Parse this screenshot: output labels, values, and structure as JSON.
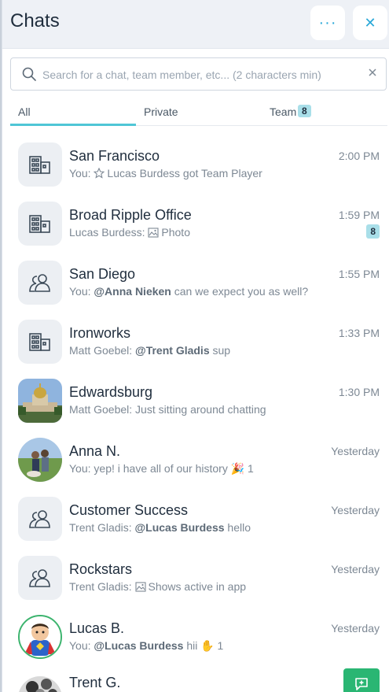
{
  "header": {
    "title": "Chats",
    "more_label": "···",
    "close_label": "✕"
  },
  "search": {
    "placeholder": "Search for a chat, team member, etc... (2 characters min)",
    "value": ""
  },
  "tabs": [
    {
      "label": "All",
      "active": true
    },
    {
      "label": "Private"
    },
    {
      "label": "Team",
      "badge": "8"
    }
  ],
  "chats": [
    {
      "name": "San Francisco",
      "time": "2:00 PM",
      "avatar": "building-icon",
      "preview_prefix": "You: ",
      "preview_icon": "star-icon",
      "preview_text": "Lucas Burdess got Team Player"
    },
    {
      "name": "Broad Ripple Office",
      "time": "1:59 PM",
      "avatar": "building-icon",
      "preview_prefix": "Lucas Burdess: ",
      "preview_icon": "image-icon",
      "preview_text": "Photo",
      "unread": "8"
    },
    {
      "name": "San Diego",
      "time": "1:55 PM",
      "avatar": "group-icon",
      "preview_prefix": "You: ",
      "preview_mention": "@Anna Nieken",
      "preview_text": " can we expect you as well?"
    },
    {
      "name": "Ironworks",
      "time": "1:33 PM",
      "avatar": "building-icon",
      "preview_prefix": "Matt Goebel: ",
      "preview_mention": "@Trent Gladis",
      "preview_text": " sup"
    },
    {
      "name": "Edwardsburg",
      "time": "1:30 PM",
      "avatar": "photo-building",
      "preview_prefix": "Matt Goebel: ",
      "preview_text": "Just sitting around chatting"
    },
    {
      "name": "Anna N.",
      "time": "Yesterday",
      "avatar": "photo-people",
      "preview_prefix": "You: ",
      "preview_text": "yep! i have all of our history ",
      "preview_reaction": "🎉",
      "preview_count": " 1"
    },
    {
      "name": "Customer Success",
      "time": "Yesterday",
      "avatar": "group-icon",
      "preview_prefix": "Trent Gladis: ",
      "preview_mention": "@Lucas Burdess",
      "preview_text": " hello"
    },
    {
      "name": "Rockstars",
      "time": "Yesterday",
      "avatar": "group-icon",
      "preview_prefix": "Trent Gladis: ",
      "preview_icon": "image-icon",
      "preview_text": "Shows active in app"
    },
    {
      "name": "Lucas B.",
      "time": "Yesterday",
      "avatar": "photo-superhero",
      "preview_prefix": "You: ",
      "preview_mention": "@Lucas Burdess",
      "preview_text": " hii ",
      "preview_reaction": "✋",
      "preview_count": " 1"
    },
    {
      "name": "Trent G.",
      "time": "Ye",
      "avatar": "photo-dog"
    }
  ],
  "colors": {
    "accent": "#2aa8d8",
    "tab_underline": "#4fc6d6",
    "badge_bg": "#a9dfe9",
    "fab_bg": "#2ab673"
  }
}
